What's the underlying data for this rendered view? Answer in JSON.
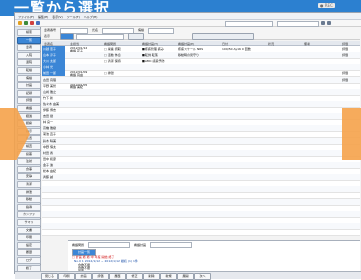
{
  "banner": {
    "title": "一覧から選択",
    "rec_label": "● REC"
  },
  "window": {
    "menu": [
      "ファイル(F)",
      "編集(E)",
      "表示(V)",
      "ツール(T)",
      "ヘルプ(H)"
    ],
    "toolbar_search": "",
    "toolbar_user": "",
    "filter_labels": [
      "患者番号",
      "氏名",
      "病棟",
      "表示"
    ],
    "table_headers": [
      "患者名",
      "主担当",
      "看護問題",
      "看護計画(T)",
      "看護計画(E)",
      "日付",
      "状況",
      "備考",
      "評価"
    ],
    "sidebar": [
      "検索",
      "一覧",
      "患者",
      "入院",
      "退院",
      "転棟",
      "病棟",
      "計画",
      "記録",
      "評価",
      "看護",
      "経過",
      "観察",
      "指示",
      "処置",
      "検査",
      "投薬",
      "注射",
      "食事",
      "安静",
      "清潔",
      "排泄",
      "移動",
      "指導",
      "カンファ",
      "サマリ",
      "文書",
      "印刷",
      "設定",
      "履歴",
      "ログ",
      "終了"
    ],
    "patients": [
      {
        "name": "川越 恵子",
        "sel": true
      },
      {
        "name": "山本 淳子",
        "sel": true
      },
      {
        "name": "大川 太郎",
        "sel": true
      },
      {
        "name": "小林 光",
        "sel": true
      },
      {
        "name": "前田 一郎",
        "sel": true
      },
      {
        "name": "古田 真理",
        "sel": false
      },
      {
        "name": "平野 美智",
        "sel": false
      },
      {
        "name": "山崎 雅之",
        "sel": false
      },
      {
        "name": "竹下 新",
        "sel": false
      },
      {
        "name": "佐々木 由美",
        "sel": false
      },
      {
        "name": "伊藤 博志",
        "sel": false
      },
      {
        "name": "吉田 健",
        "sel": false
      },
      {
        "name": "林 良一",
        "sel": false
      },
      {
        "name": "高橋 雅樹",
        "sel": false
      },
      {
        "name": "菊池 直子",
        "sel": false
      },
      {
        "name": "鈴木 晴美",
        "sel": false
      },
      {
        "name": "中野 慎太",
        "sel": false
      },
      {
        "name": "村田 香",
        "sel": false
      },
      {
        "name": "田中 和彦",
        "sel": false
      },
      {
        "name": "金子 進",
        "sel": false
      },
      {
        "name": "松本 由紀",
        "sel": false
      },
      {
        "name": "斉藤 誠",
        "sel": false
      }
    ],
    "plans": [
      {
        "date": "2012/01/12",
        "staff": "看護 花子",
        "problem": "□ 栄養 摂取",
        "plan": "■疼痛管理 痛み",
        "plan2": "疼痛スケール NRS",
        "flag": "100/50 Ay16 0 回数",
        "status": "",
        "note": "",
        "eval": "評価"
      },
      {
        "date": "",
        "staff": "",
        "problem": "□ 活動 休息",
        "plan": "■転倒 転落",
        "plan2": "移動時の見守り",
        "flag": "",
        "status": "",
        "note": "",
        "eval": "評価"
      },
      {
        "date": "",
        "staff": "",
        "problem": "□ 清潔 保持",
        "plan": "■AMC 感染予防",
        "plan2": "",
        "flag": "",
        "status": "",
        "note": "",
        "eval": ""
      },
      {
        "date": "",
        "staff": "",
        "problem": "",
        "plan": "",
        "plan2": "",
        "flag": "",
        "status": "",
        "note": "",
        "eval": ""
      },
      {
        "date": "2012/01/09",
        "staff": "看護 真由",
        "problem": "□ 排泄",
        "plan": "",
        "plan2": "",
        "flag": "",
        "status": "",
        "note": "",
        "eval": "評価"
      },
      {
        "date": "",
        "staff": "",
        "problem": "",
        "plan": "",
        "plan2": "",
        "flag": "",
        "status": "",
        "note": "",
        "eval": "評価"
      },
      {
        "date": "2012/01/05",
        "staff": "看護 美紀",
        "problem": "",
        "plan": "",
        "plan2": "",
        "flag": "",
        "status": "",
        "note": "",
        "eval": ""
      },
      {
        "date": "",
        "staff": "",
        "problem": "",
        "plan": "",
        "plan2": "",
        "flag": "",
        "status": "",
        "note": "",
        "eval": ""
      }
    ],
    "detail": {
      "label_a": "看護問題",
      "label_b": "看護計画",
      "link": "計画一覧",
      "line1": "□ 計画 終 終 中 年度 開始 終了",
      "line2": "No.0 1 2012/1/12 ~ 2012/1/12 継続 (1) 1件",
      "items": [
        "食欲不振",
        "食欲不振",
        "栄養",
        "* M234 P-2000-0033 1g   1日"
      ]
    },
    "bottom": [
      "閉じる",
      "印刷",
      "計画",
      "評価",
      "履歴",
      "修正",
      "削除",
      "新規",
      "展開",
      "次へ"
    ]
  }
}
